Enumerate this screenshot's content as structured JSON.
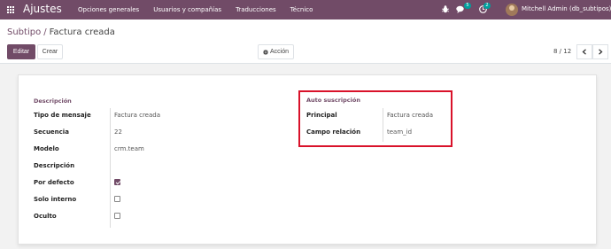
{
  "navbar": {
    "brand": "Ajustes",
    "menu": [
      "Opciones generales",
      "Usuarios y compañías",
      "Traducciones",
      "Técnico"
    ],
    "messages_count": "5",
    "activities_count": "2",
    "user": "Mitchell Admin (db_subtipos)",
    "bg_color": "#714b67"
  },
  "breadcrumb": {
    "parent": "Subtipo",
    "separator": "/",
    "current": "Factura creada"
  },
  "buttons": {
    "edit": "Editar",
    "create": "Crear",
    "action": "Acción",
    "action_icon": "gear-icon"
  },
  "pager": {
    "value": "8 / 12"
  },
  "form": {
    "descripcion_group": "Descripción",
    "auto_group": "Auto suscripción",
    "fields": {
      "tipo_mensaje": {
        "label": "Tipo de mensaje",
        "value": "Factura creada"
      },
      "secuencia": {
        "label": "Secuencia",
        "value": "22"
      },
      "modelo": {
        "label": "Modelo",
        "value": "crm.team"
      },
      "descripcion": {
        "label": "Descripción",
        "value": ""
      },
      "por_defecto": {
        "label": "Por defecto",
        "checked": true
      },
      "solo_interno": {
        "label": "Solo interno",
        "checked": false
      },
      "oculto": {
        "label": "Oculto",
        "checked": false
      },
      "principal": {
        "label": "Principal",
        "value": "Factura creada"
      },
      "campo_relacion": {
        "label": "Campo relación",
        "value": "team_id"
      }
    }
  }
}
